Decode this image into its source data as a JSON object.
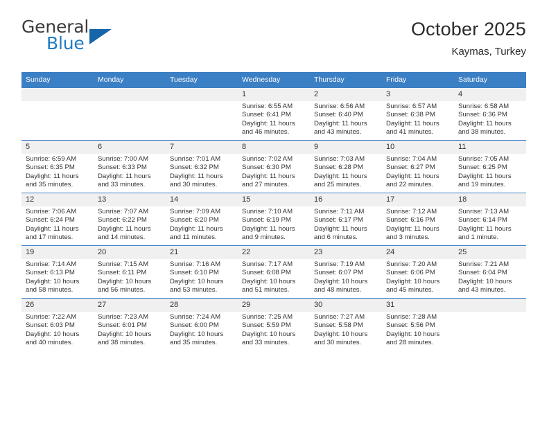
{
  "brand": {
    "line1": "General",
    "line2": "Blue",
    "mark": "triangle-logo"
  },
  "header": {
    "title": "October 2025",
    "subtitle": "Kaymas, Turkey"
  },
  "colors": {
    "header_blue": "#3b7fc4",
    "brand_blue": "#1f7bc4",
    "logo_blue": "#1565a8",
    "daynum_bg": "#f0f0f0",
    "text": "#333333"
  },
  "weekdays": [
    "Sunday",
    "Monday",
    "Tuesday",
    "Wednesday",
    "Thursday",
    "Friday",
    "Saturday"
  ],
  "labels": {
    "sunrise": "Sunrise:",
    "sunset": "Sunset:",
    "daylight": "Daylight:"
  },
  "weeks": [
    [
      {
        "day": "",
        "empty": true
      },
      {
        "day": "",
        "empty": true
      },
      {
        "day": "",
        "empty": true
      },
      {
        "day": "1",
        "sunrise": "Sunrise: 6:55 AM",
        "sunset": "Sunset: 6:41 PM",
        "daylight1": "Daylight: 11 hours",
        "daylight2": "and 46 minutes."
      },
      {
        "day": "2",
        "sunrise": "Sunrise: 6:56 AM",
        "sunset": "Sunset: 6:40 PM",
        "daylight1": "Daylight: 11 hours",
        "daylight2": "and 43 minutes."
      },
      {
        "day": "3",
        "sunrise": "Sunrise: 6:57 AM",
        "sunset": "Sunset: 6:38 PM",
        "daylight1": "Daylight: 11 hours",
        "daylight2": "and 41 minutes."
      },
      {
        "day": "4",
        "sunrise": "Sunrise: 6:58 AM",
        "sunset": "Sunset: 6:36 PM",
        "daylight1": "Daylight: 11 hours",
        "daylight2": "and 38 minutes."
      }
    ],
    [
      {
        "day": "5",
        "sunrise": "Sunrise: 6:59 AM",
        "sunset": "Sunset: 6:35 PM",
        "daylight1": "Daylight: 11 hours",
        "daylight2": "and 35 minutes."
      },
      {
        "day": "6",
        "sunrise": "Sunrise: 7:00 AM",
        "sunset": "Sunset: 6:33 PM",
        "daylight1": "Daylight: 11 hours",
        "daylight2": "and 33 minutes."
      },
      {
        "day": "7",
        "sunrise": "Sunrise: 7:01 AM",
        "sunset": "Sunset: 6:32 PM",
        "daylight1": "Daylight: 11 hours",
        "daylight2": "and 30 minutes."
      },
      {
        "day": "8",
        "sunrise": "Sunrise: 7:02 AM",
        "sunset": "Sunset: 6:30 PM",
        "daylight1": "Daylight: 11 hours",
        "daylight2": "and 27 minutes."
      },
      {
        "day": "9",
        "sunrise": "Sunrise: 7:03 AM",
        "sunset": "Sunset: 6:28 PM",
        "daylight1": "Daylight: 11 hours",
        "daylight2": "and 25 minutes."
      },
      {
        "day": "10",
        "sunrise": "Sunrise: 7:04 AM",
        "sunset": "Sunset: 6:27 PM",
        "daylight1": "Daylight: 11 hours",
        "daylight2": "and 22 minutes."
      },
      {
        "day": "11",
        "sunrise": "Sunrise: 7:05 AM",
        "sunset": "Sunset: 6:25 PM",
        "daylight1": "Daylight: 11 hours",
        "daylight2": "and 19 minutes."
      }
    ],
    [
      {
        "day": "12",
        "sunrise": "Sunrise: 7:06 AM",
        "sunset": "Sunset: 6:24 PM",
        "daylight1": "Daylight: 11 hours",
        "daylight2": "and 17 minutes."
      },
      {
        "day": "13",
        "sunrise": "Sunrise: 7:07 AM",
        "sunset": "Sunset: 6:22 PM",
        "daylight1": "Daylight: 11 hours",
        "daylight2": "and 14 minutes."
      },
      {
        "day": "14",
        "sunrise": "Sunrise: 7:09 AM",
        "sunset": "Sunset: 6:20 PM",
        "daylight1": "Daylight: 11 hours",
        "daylight2": "and 11 minutes."
      },
      {
        "day": "15",
        "sunrise": "Sunrise: 7:10 AM",
        "sunset": "Sunset: 6:19 PM",
        "daylight1": "Daylight: 11 hours",
        "daylight2": "and 9 minutes."
      },
      {
        "day": "16",
        "sunrise": "Sunrise: 7:11 AM",
        "sunset": "Sunset: 6:17 PM",
        "daylight1": "Daylight: 11 hours",
        "daylight2": "and 6 minutes."
      },
      {
        "day": "17",
        "sunrise": "Sunrise: 7:12 AM",
        "sunset": "Sunset: 6:16 PM",
        "daylight1": "Daylight: 11 hours",
        "daylight2": "and 3 minutes."
      },
      {
        "day": "18",
        "sunrise": "Sunrise: 7:13 AM",
        "sunset": "Sunset: 6:14 PM",
        "daylight1": "Daylight: 11 hours",
        "daylight2": "and 1 minute."
      }
    ],
    [
      {
        "day": "19",
        "sunrise": "Sunrise: 7:14 AM",
        "sunset": "Sunset: 6:13 PM",
        "daylight1": "Daylight: 10 hours",
        "daylight2": "and 58 minutes."
      },
      {
        "day": "20",
        "sunrise": "Sunrise: 7:15 AM",
        "sunset": "Sunset: 6:11 PM",
        "daylight1": "Daylight: 10 hours",
        "daylight2": "and 56 minutes."
      },
      {
        "day": "21",
        "sunrise": "Sunrise: 7:16 AM",
        "sunset": "Sunset: 6:10 PM",
        "daylight1": "Daylight: 10 hours",
        "daylight2": "and 53 minutes."
      },
      {
        "day": "22",
        "sunrise": "Sunrise: 7:17 AM",
        "sunset": "Sunset: 6:08 PM",
        "daylight1": "Daylight: 10 hours",
        "daylight2": "and 51 minutes."
      },
      {
        "day": "23",
        "sunrise": "Sunrise: 7:19 AM",
        "sunset": "Sunset: 6:07 PM",
        "daylight1": "Daylight: 10 hours",
        "daylight2": "and 48 minutes."
      },
      {
        "day": "24",
        "sunrise": "Sunrise: 7:20 AM",
        "sunset": "Sunset: 6:06 PM",
        "daylight1": "Daylight: 10 hours",
        "daylight2": "and 45 minutes."
      },
      {
        "day": "25",
        "sunrise": "Sunrise: 7:21 AM",
        "sunset": "Sunset: 6:04 PM",
        "daylight1": "Daylight: 10 hours",
        "daylight2": "and 43 minutes."
      }
    ],
    [
      {
        "day": "26",
        "sunrise": "Sunrise: 7:22 AM",
        "sunset": "Sunset: 6:03 PM",
        "daylight1": "Daylight: 10 hours",
        "daylight2": "and 40 minutes."
      },
      {
        "day": "27",
        "sunrise": "Sunrise: 7:23 AM",
        "sunset": "Sunset: 6:01 PM",
        "daylight1": "Daylight: 10 hours",
        "daylight2": "and 38 minutes."
      },
      {
        "day": "28",
        "sunrise": "Sunrise: 7:24 AM",
        "sunset": "Sunset: 6:00 PM",
        "daylight1": "Daylight: 10 hours",
        "daylight2": "and 35 minutes."
      },
      {
        "day": "29",
        "sunrise": "Sunrise: 7:25 AM",
        "sunset": "Sunset: 5:59 PM",
        "daylight1": "Daylight: 10 hours",
        "daylight2": "and 33 minutes."
      },
      {
        "day": "30",
        "sunrise": "Sunrise: 7:27 AM",
        "sunset": "Sunset: 5:58 PM",
        "daylight1": "Daylight: 10 hours",
        "daylight2": "and 30 minutes."
      },
      {
        "day": "31",
        "sunrise": "Sunrise: 7:28 AM",
        "sunset": "Sunset: 5:56 PM",
        "daylight1": "Daylight: 10 hours",
        "daylight2": "and 28 minutes."
      },
      {
        "day": "",
        "empty": true
      }
    ]
  ]
}
